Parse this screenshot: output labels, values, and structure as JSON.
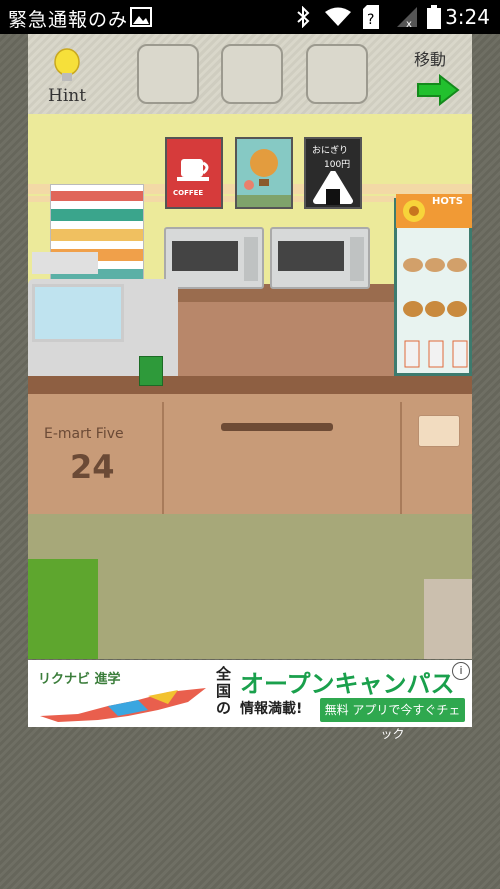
{
  "status_bar": {
    "title": "緊急通報のみ",
    "time": "3:24",
    "icons": [
      "image-icon",
      "bluetooth-icon",
      "wifi-icon",
      "sim-unknown-icon",
      "signal-icon",
      "battery-icon"
    ]
  },
  "top_bar": {
    "hint_label": "Hint",
    "move_label": "移動",
    "item_slots": 3,
    "icons": [
      "lightbulb-icon",
      "right-arrow-icon"
    ]
  },
  "scene": {
    "posters": {
      "coffee": "COFFEE",
      "onigiri_line1": "おにぎり",
      "onigiri_line2": "100円"
    },
    "hot_case_sign": "HOTS",
    "store_name": "E-mart Five",
    "store_number": "24"
  },
  "ad": {
    "brand": "リクナビ 進学",
    "side_text": "全国の",
    "headline": "オープンキャンパス",
    "sub": "情報満載!",
    "cta": "無料 アプリで今すぐチェック",
    "info": "i"
  },
  "colors": {
    "accent_green": "#1aa04c",
    "arrow_green": "#22c02e",
    "wall": "#ecea9a",
    "counter": "#c89b78"
  }
}
